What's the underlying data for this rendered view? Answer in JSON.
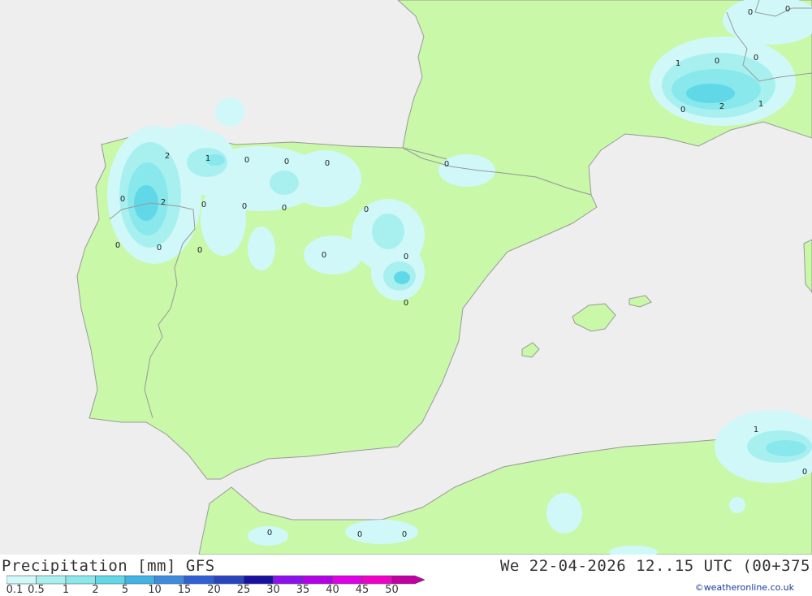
{
  "header": {
    "title": "Precipitation [mm] GFS",
    "datetime": "We 22-04-2026 12..15 UTC (00+375"
  },
  "legend": {
    "levels": [
      "0.1",
      "0.5",
      "1",
      "2",
      "5",
      "10",
      "15",
      "20",
      "25",
      "30",
      "35",
      "40",
      "45",
      "50"
    ],
    "colors": [
      "#d0f8f8",
      "#a8f0f0",
      "#88e8ec",
      "#60d8e8",
      "#40b4e4",
      "#3c8ce0",
      "#3060d8",
      "#2844c0",
      "#1810a0",
      "#8c10f0",
      "#b400e8",
      "#e000e8",
      "#f000c8",
      "#c000a0"
    ]
  },
  "credit": "©weatheronline.co.uk",
  "map": {
    "colors": {
      "sea": "#eeeeee",
      "land": "#c8f8a8",
      "border": "#999999"
    },
    "labels": [
      {
        "text": "2"
      },
      {
        "text": "1"
      },
      {
        "text": "0"
      },
      {
        "text": "0"
      },
      {
        "text": "0"
      },
      {
        "text": "0"
      },
      {
        "text": "2"
      },
      {
        "text": "0"
      },
      {
        "text": "0"
      },
      {
        "text": "0"
      },
      {
        "text": "0"
      },
      {
        "text": "0"
      },
      {
        "text": "0"
      },
      {
        "text": "0"
      },
      {
        "text": "0"
      },
      {
        "text": "0"
      },
      {
        "text": "0"
      },
      {
        "text": "0"
      },
      {
        "text": "0"
      },
      {
        "text": "0"
      },
      {
        "text": "1"
      },
      {
        "text": "0"
      },
      {
        "text": "0"
      },
      {
        "text": "0"
      },
      {
        "text": "2"
      },
      {
        "text": "1"
      },
      {
        "text": "1"
      },
      {
        "text": "0"
      },
      {
        "text": "0"
      },
      {
        "text": "0"
      },
      {
        "text": "0"
      }
    ]
  }
}
